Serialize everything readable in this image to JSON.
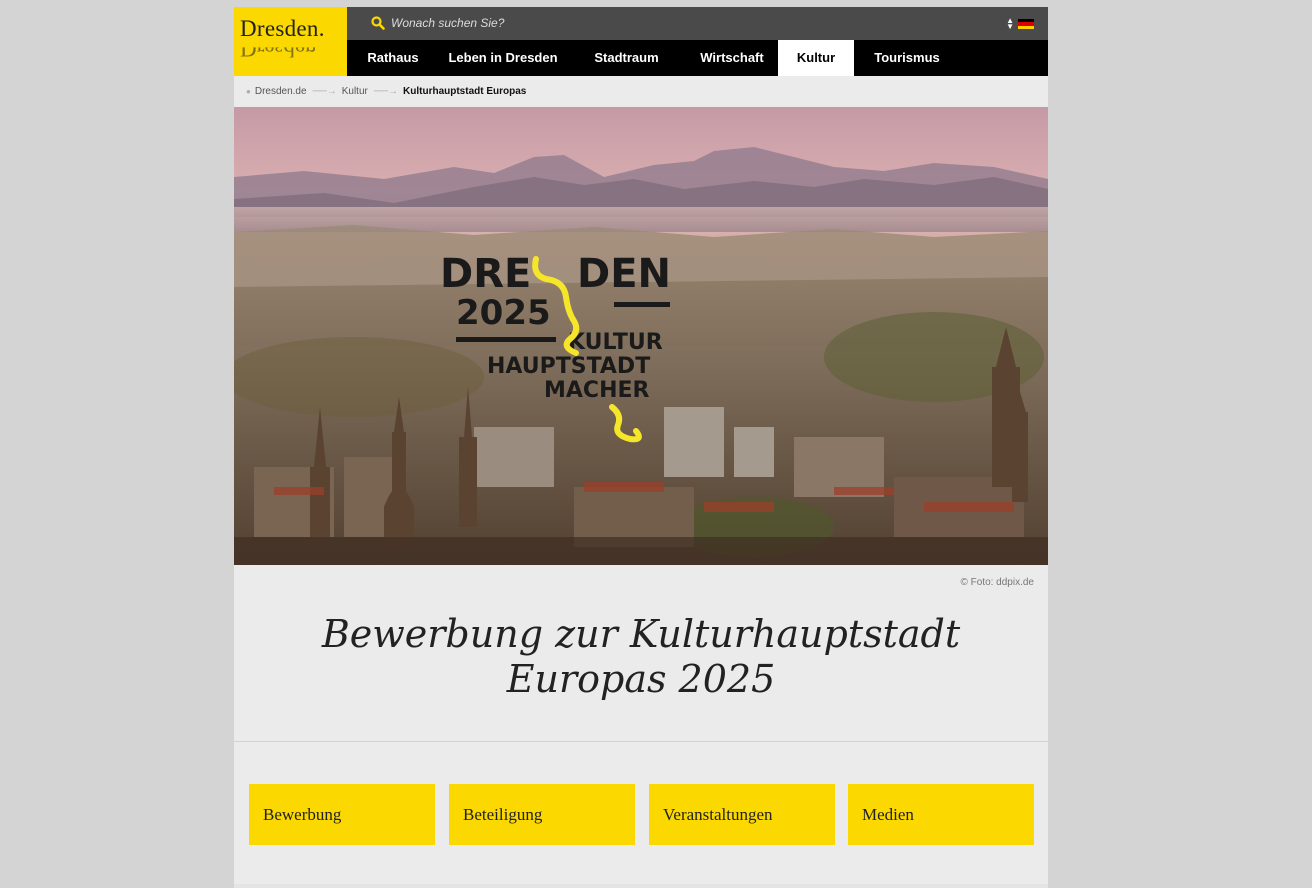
{
  "header": {
    "logo_text": "Dresden.",
    "search": {
      "placeholder": "Wonach suchen Sie?",
      "value": ""
    },
    "language": "de"
  },
  "nav": {
    "items": [
      {
        "label": "Rathaus"
      },
      {
        "label": "Leben in Dresden"
      },
      {
        "label": "Stadtraum"
      },
      {
        "label": "Wirtschaft"
      },
      {
        "label": "Kultur",
        "active": true
      },
      {
        "label": "Tourismus"
      }
    ]
  },
  "breadcrumb": {
    "items": [
      "Dresden.de",
      "Kultur",
      "Kulturhauptstadt Europas"
    ]
  },
  "hero": {
    "logo_lines": [
      "DRE",
      "DEN",
      "2025",
      "KULTUR",
      "HAUPTSTADT",
      "MACHER"
    ],
    "caption": "© Foto: ddpix.de"
  },
  "main": {
    "title": "Bewerbung zur Kulturhauptstadt Europas 2025",
    "tiles": [
      "Bewerbung",
      "Beteiligung",
      "Veranstaltungen",
      "Medien"
    ]
  },
  "colors": {
    "brand_yellow": "#fbd800",
    "nav_black": "#000000",
    "search_bar": "#4a4a4a",
    "page_bg": "#ebebeb",
    "outer_bg": "#d4d4d4"
  }
}
